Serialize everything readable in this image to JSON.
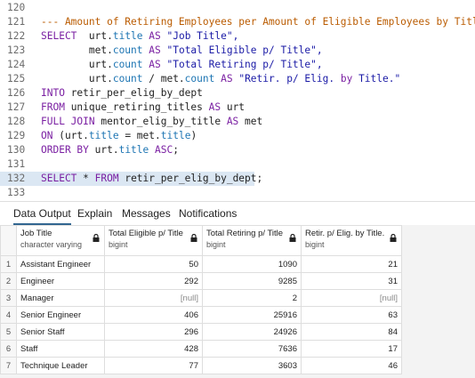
{
  "editor": {
    "lines": [
      {
        "num": "120",
        "segments": []
      },
      {
        "num": "121",
        "segments": [
          {
            "t": "--- Amount of Retiring Employees per Amount of Eligible Employees by Title.",
            "c": "cmt"
          }
        ]
      },
      {
        "num": "122",
        "segments": [
          {
            "t": "SELECT",
            "c": "kw"
          },
          {
            "t": "  urt.",
            "c": ""
          },
          {
            "t": "title",
            "c": "fn"
          },
          {
            "t": " ",
            "c": ""
          },
          {
            "t": "AS",
            "c": "kw"
          },
          {
            "t": " \"Job Title\",",
            "c": "str"
          }
        ]
      },
      {
        "num": "123",
        "segments": [
          {
            "t": "        met.",
            "c": ""
          },
          {
            "t": "count",
            "c": "fn"
          },
          {
            "t": " ",
            "c": ""
          },
          {
            "t": "AS",
            "c": "kw"
          },
          {
            "t": " \"Total Eligible p/ Title\",",
            "c": "str"
          }
        ]
      },
      {
        "num": "124",
        "segments": [
          {
            "t": "        urt.",
            "c": ""
          },
          {
            "t": "count",
            "c": "fn"
          },
          {
            "t": " ",
            "c": ""
          },
          {
            "t": "AS",
            "c": "kw"
          },
          {
            "t": " \"Total Retiring p/ Title\",",
            "c": "str"
          }
        ]
      },
      {
        "num": "125",
        "segments": [
          {
            "t": "        urt.",
            "c": ""
          },
          {
            "t": "count",
            "c": "fn"
          },
          {
            "t": " / met.",
            "c": ""
          },
          {
            "t": "count",
            "c": "fn"
          },
          {
            "t": " ",
            "c": ""
          },
          {
            "t": "AS",
            "c": "kw"
          },
          {
            "t": " \"Retir. p/ Elig. ",
            "c": "str"
          },
          {
            "t": "by",
            "c": "kw"
          },
          {
            "t": " Title.\"",
            "c": "str"
          }
        ]
      },
      {
        "num": "126",
        "segments": [
          {
            "t": "INTO",
            "c": "kw"
          },
          {
            "t": " retir_per_elig_by_dept",
            "c": ""
          }
        ]
      },
      {
        "num": "127",
        "segments": [
          {
            "t": "FROM",
            "c": "kw"
          },
          {
            "t": " unique_retiring_titles ",
            "c": ""
          },
          {
            "t": "AS",
            "c": "kw"
          },
          {
            "t": " urt",
            "c": ""
          }
        ]
      },
      {
        "num": "128",
        "segments": [
          {
            "t": "FULL JOIN",
            "c": "kw"
          },
          {
            "t": " mentor_elig_by_title ",
            "c": ""
          },
          {
            "t": "AS",
            "c": "kw"
          },
          {
            "t": " met",
            "c": ""
          }
        ]
      },
      {
        "num": "129",
        "segments": [
          {
            "t": "ON",
            "c": "kw"
          },
          {
            "t": " (urt.",
            "c": ""
          },
          {
            "t": "title",
            "c": "fn"
          },
          {
            "t": " = met.",
            "c": ""
          },
          {
            "t": "title",
            "c": "fn"
          },
          {
            "t": ")",
            "c": ""
          }
        ]
      },
      {
        "num": "130",
        "segments": [
          {
            "t": "ORDER BY",
            "c": "kw"
          },
          {
            "t": " urt.",
            "c": ""
          },
          {
            "t": "title",
            "c": "fn"
          },
          {
            "t": " ",
            "c": ""
          },
          {
            "t": "ASC",
            "c": "kw"
          },
          {
            "t": ";",
            "c": ""
          }
        ]
      },
      {
        "num": "131",
        "segments": []
      },
      {
        "num": "132",
        "highlight": true,
        "segments": [
          {
            "t": "SELECT",
            "c": "kw"
          },
          {
            "t": " * ",
            "c": ""
          },
          {
            "t": "FROM",
            "c": "kw"
          },
          {
            "t": " retir_per_elig_by_dept;",
            "c": ""
          }
        ]
      },
      {
        "num": "133",
        "segments": []
      }
    ]
  },
  "tabs": [
    {
      "label": "Data Output",
      "active": true
    },
    {
      "label": "Explain",
      "active": false
    },
    {
      "label": "Messages",
      "active": false
    },
    {
      "label": "Notifications",
      "active": false
    }
  ],
  "grid": {
    "columns": [
      {
        "name": "Job Title",
        "type": "character varying"
      },
      {
        "name": "Total Eligible p/ Title",
        "type": "bigint"
      },
      {
        "name": "Total Retiring p/ Title",
        "type": "bigint"
      },
      {
        "name": "Retir. p/ Elig. by Title.",
        "type": "bigint"
      }
    ],
    "rows": [
      [
        "1",
        "Assistant Engineer",
        "50",
        "1090",
        "21"
      ],
      [
        "2",
        "Engineer",
        "292",
        "9285",
        "31"
      ],
      [
        "3",
        "Manager",
        "[null]",
        "2",
        "[null]"
      ],
      [
        "4",
        "Senior Engineer",
        "406",
        "25916",
        "63"
      ],
      [
        "5",
        "Senior Staff",
        "296",
        "24926",
        "84"
      ],
      [
        "6",
        "Staff",
        "428",
        "7636",
        "17"
      ],
      [
        "7",
        "Technique Leader",
        "77",
        "3603",
        "46"
      ]
    ]
  }
}
